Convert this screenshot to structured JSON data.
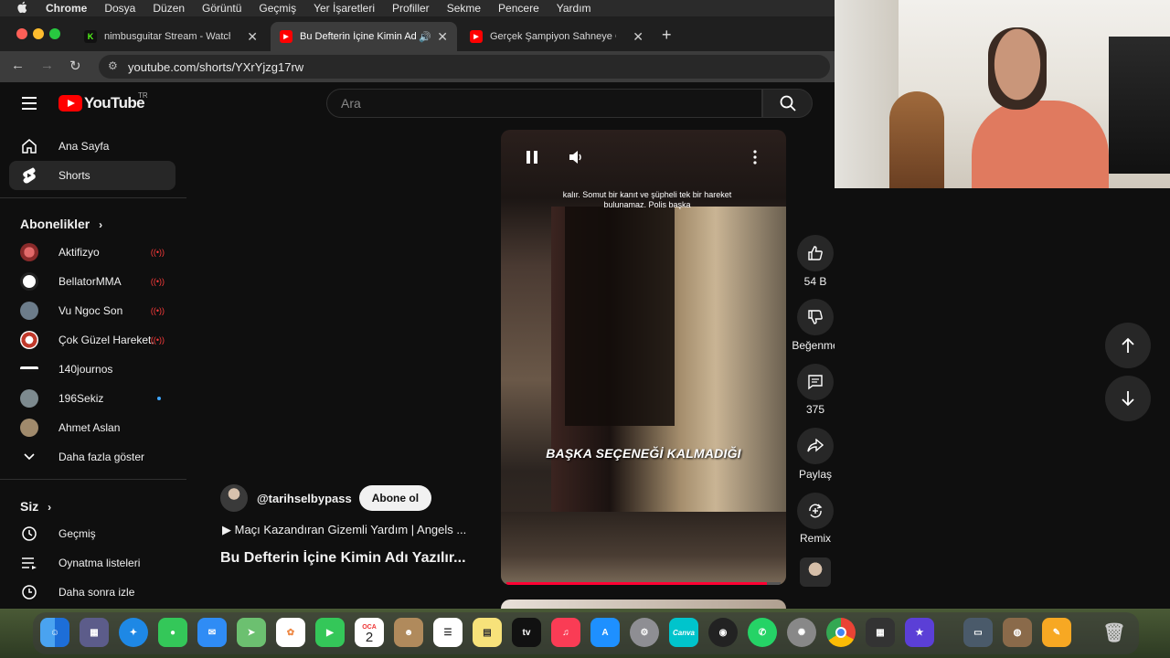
{
  "menubar": {
    "apple": "",
    "app": "Chrome",
    "items": [
      "Dosya",
      "Düzen",
      "Görüntü",
      "Geçmiş",
      "Yer İşaretleri",
      "Profiller",
      "Sekme",
      "Pencere",
      "Yardım"
    ]
  },
  "tabs": [
    {
      "title": "nimbusguitar Stream - Watch",
      "favicon": "K",
      "favicon_color": "#53fc18"
    },
    {
      "title": "Bu Defterin İçine Kimin Ad",
      "favicon": "▶",
      "favicon_color": "#ff0000"
    },
    {
      "title": "Gerçek Şampiyon Sahneye Ç",
      "favicon": "▶",
      "favicon_color": "#ff0000"
    }
  ],
  "address": {
    "url": "youtube.com/shorts/YXrYjzg17rw"
  },
  "youtube": {
    "logo_text": "YouTube",
    "region": "TR",
    "search_placeholder": "Ara"
  },
  "sidebar": {
    "main": [
      {
        "label": "Ana Sayfa",
        "icon": "home-icon"
      },
      {
        "label": "Shorts",
        "icon": "shorts-icon"
      }
    ],
    "subscriptions_header": "Abonelikler",
    "subscriptions": [
      {
        "label": "Aktifizyo",
        "status": "live"
      },
      {
        "label": "BellatorMMA",
        "status": "live"
      },
      {
        "label": "Vu Ngoc Son",
        "status": "live"
      },
      {
        "label": "Çok Güzel Hareket...",
        "status": "live"
      },
      {
        "label": "140journos",
        "status": ""
      },
      {
        "label": "196Sekiz",
        "status": "new"
      },
      {
        "label": "Ahmet Aslan",
        "status": ""
      }
    ],
    "show_more": "Daha fazla göster",
    "you_header": "Siz",
    "you_items": [
      {
        "label": "Geçmiş",
        "icon": "history-icon"
      },
      {
        "label": "Oynatma listeleri",
        "icon": "playlist-icon"
      },
      {
        "label": "Daha sonra izle",
        "icon": "clock-icon"
      }
    ]
  },
  "short": {
    "caption_top": "kalır. Somut bir kanıt ve şüpheli tek bir hareket bulunamaz. Polis başka",
    "caption_main": "BAŞKA SEÇENEĞİ KALMADIĞI",
    "channel_handle": "@tarihselbypass",
    "subscribe_label": "Abone ol",
    "playlist_label": "▶  Maçı Kazandıran Gizemli Yardım | Angels ...",
    "title": "Bu Defterin İçine Kimin Adı Yazılır...",
    "progress": 0.95
  },
  "actions": {
    "like_count": "54 B",
    "dislike_label": "Beğenme",
    "comment_count": "375",
    "share_label": "Paylaş",
    "remix_label": "Remix"
  },
  "dock": {
    "calendar_month": "OCA",
    "calendar_day": "2",
    "tv_label": "tv",
    "canva_label": "Canva"
  }
}
